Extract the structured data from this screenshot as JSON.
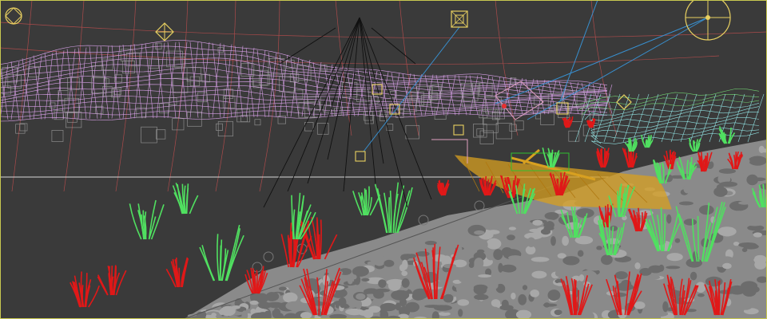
{
  "viewport": {
    "background": "#3a3a3a",
    "border_color": "#c8c850",
    "horizon_line_color": "#d8d8d8"
  },
  "scene": {
    "colors": {
      "terrain_wire": "#d8a0e8",
      "bbox_boxes": "#b0b0b0",
      "grid_lines": "#d05050",
      "rock_fill": "#8a8a8a",
      "rock_dark": "#6c6c6c",
      "rock_light": "#a8a8a8",
      "grass_red": "#e01818",
      "grass_green": "#50e060",
      "boat": "#d8a020",
      "boat_selection": "#30c030",
      "shore_mesh": "#90e0e0",
      "shore_mesh_green": "#70d070",
      "camera": "#e8d060",
      "light_lines": "#3890d0",
      "frustum_lines": "#101010",
      "helper_pink": "#e0a0c0"
    },
    "objects": [
      {
        "name": "mountain-terrain-wireframe",
        "kind": "mesh"
      },
      {
        "name": "rocky-ground-mesh",
        "kind": "mesh"
      },
      {
        "name": "rowboat-mesh",
        "kind": "mesh"
      },
      {
        "name": "shoreline-mesh",
        "kind": "mesh"
      },
      {
        "name": "red-grass-scatter",
        "kind": "scatter"
      },
      {
        "name": "green-grass-scatter",
        "kind": "scatter"
      },
      {
        "name": "camera-frustum",
        "kind": "camera"
      },
      {
        "name": "directional-light",
        "kind": "light"
      }
    ],
    "helper_icons": [
      "camera-icon",
      "camera-icon",
      "camera-icon",
      "light-icon",
      "sun-light-icon",
      "camera-icon"
    ]
  }
}
